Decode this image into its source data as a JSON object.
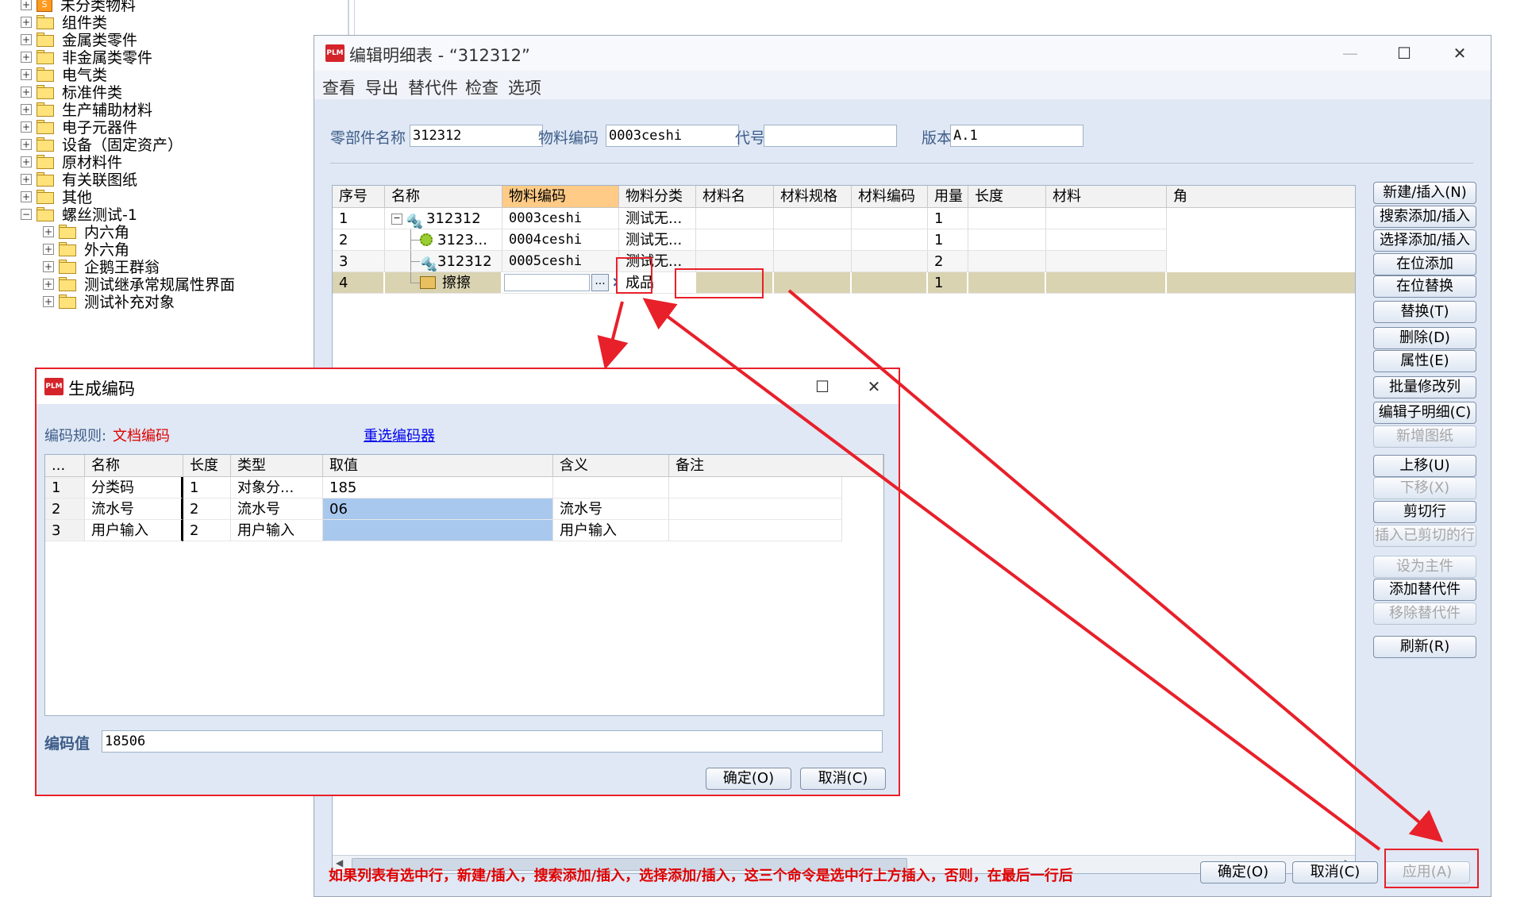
{
  "tree": {
    "items": [
      {
        "label": "未分类物料",
        "indent": 0,
        "special": true
      },
      {
        "label": "组件类",
        "indent": 0
      },
      {
        "label": "金属类零件",
        "indent": 0
      },
      {
        "label": "非金属类零件",
        "indent": 0
      },
      {
        "label": "电气类",
        "indent": 0
      },
      {
        "label": "标准件类",
        "indent": 0
      },
      {
        "label": "生产辅助材料",
        "indent": 0
      },
      {
        "label": "电子元器件",
        "indent": 0
      },
      {
        "label": "设备（固定资产）",
        "indent": 0
      },
      {
        "label": "原材料件",
        "indent": 0
      },
      {
        "label": "有关联图纸",
        "indent": 0
      },
      {
        "label": "其他",
        "indent": 0
      },
      {
        "label": "螺丝测试-1",
        "indent": 0,
        "expanded": true
      },
      {
        "label": "内六角",
        "indent": 1
      },
      {
        "label": "外六角",
        "indent": 1
      },
      {
        "label": "企鹅王群翁",
        "indent": 1
      },
      {
        "label": "测试继承常规属性界面",
        "indent": 1
      },
      {
        "label": "测试补充对象",
        "indent": 1
      }
    ]
  },
  "main_window": {
    "title": "编辑明细表 - “312312”",
    "menus": [
      "查看",
      "导出",
      "替代件",
      "检查",
      "选项"
    ],
    "fields": {
      "part_name_label": "零部件名称",
      "part_name": "312312",
      "material_code_label": "物料编码",
      "material_code": "0003ceshi",
      "code_label": "代号",
      "code": "",
      "version_label": "版本",
      "version": "A.1"
    },
    "columns": [
      "序号",
      "名称",
      "物料编码",
      "物料分类",
      "材料名",
      "材料规格",
      "材料编码",
      "用量",
      "长度",
      "材料",
      "角"
    ],
    "rows": [
      {
        "seq": "1",
        "name": "312312",
        "code": "0003ceshi",
        "category": "测试无...",
        "qty": "1"
      },
      {
        "seq": "2",
        "name": "3123...",
        "code": "0004ceshi",
        "category": "测试无...",
        "qty": "1"
      },
      {
        "seq": "3",
        "name": "312312",
        "code": "0005ceshi",
        "category": "测试无...",
        "qty": "2"
      },
      {
        "seq": "4",
        "name": "擦擦",
        "code": "",
        "category": "成品",
        "qty": "1"
      }
    ],
    "ellipsis_button": "...",
    "clear_button": "×",
    "side_buttons": [
      {
        "label": "新建/插入(N)",
        "enabled": true
      },
      {
        "label": "搜索添加/插入",
        "enabled": true
      },
      {
        "label": "选择添加/插入",
        "enabled": true
      },
      {
        "label": "在位添加",
        "enabled": true
      },
      {
        "label": "在位替换",
        "enabled": true
      },
      {
        "label": "替换(T)",
        "enabled": true
      },
      {
        "label": "删除(D)",
        "enabled": true
      },
      {
        "label": "属性(E)",
        "enabled": true
      },
      {
        "label": "批量修改列",
        "enabled": true
      },
      {
        "label": "编辑子明细(C)",
        "enabled": true
      },
      {
        "label": "新增图纸",
        "enabled": false
      },
      {
        "label": "上移(U)",
        "enabled": true
      },
      {
        "label": "下移(X)",
        "enabled": false
      },
      {
        "label": "剪切行",
        "enabled": true
      },
      {
        "label": "插入已剪切的行",
        "enabled": false
      },
      {
        "label": "设为主件",
        "enabled": false
      },
      {
        "label": "添加替代件",
        "enabled": true
      },
      {
        "label": "移除替代件",
        "enabled": false
      },
      {
        "label": "刷新(R)",
        "enabled": true
      }
    ],
    "hint": "如果列表有选中行，新建/插入，搜索添加/插入，选择添加/插入，这三个命令是选中行上方插入，否则，在最后一行后",
    "ok": "确定(O)",
    "cancel": "取消(C)",
    "apply": "应用(A)"
  },
  "dialog": {
    "title": "生成编码",
    "rule_label": "编码规则:",
    "rule_value": "文档编码",
    "reselect_link": "重选编码器",
    "columns": [
      "...",
      "名称",
      "长度",
      "类型",
      "取值",
      "含义",
      "备注"
    ],
    "rows": [
      {
        "seq": "1",
        "name": "分类码",
        "len": "1",
        "type": "对象分...",
        "value": "185",
        "meaning": "",
        "note": ""
      },
      {
        "seq": "2",
        "name": "流水号",
        "len": "2",
        "type": "流水号",
        "value": "06",
        "meaning": "流水号",
        "note": ""
      },
      {
        "seq": "3",
        "name": "用户输入",
        "len": "2",
        "type": "用户输入",
        "value": "",
        "meaning": "用户输入",
        "note": ""
      }
    ],
    "code_value_label": "编码值",
    "code_value": "18506",
    "ok": "确定(O)",
    "cancel": "取消(C)"
  },
  "colors": {
    "annotation": "#e8202a",
    "header_highlight": "#ffcb86",
    "selected_row": "#d9d3b2",
    "selected_cell": "#a9c8ee",
    "hint_text": "#e00000"
  }
}
